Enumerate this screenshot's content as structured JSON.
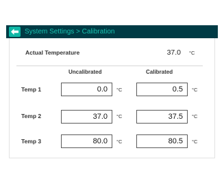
{
  "header": {
    "title": "System Settings > Calibration",
    "back_icon": "back-arrow-icon",
    "colors": {
      "bar": "#003b45",
      "accent": "#0fb7a6",
      "title": "#18c2b0"
    }
  },
  "actual": {
    "label": "Actual Temperature",
    "value": "37.0",
    "unit": "°C"
  },
  "columns": {
    "uncalibrated": "Uncalibrated",
    "calibrated": "Calibrated"
  },
  "rows": [
    {
      "label": "Temp 1",
      "uncalibrated": "0.0",
      "calibrated": "0.5",
      "unit": "°C"
    },
    {
      "label": "Temp 2",
      "uncalibrated": "37.0",
      "calibrated": "37.5",
      "unit": "°C"
    },
    {
      "label": "Temp 3",
      "uncalibrated": "80.0",
      "calibrated": "80.5",
      "unit": "°C"
    }
  ]
}
